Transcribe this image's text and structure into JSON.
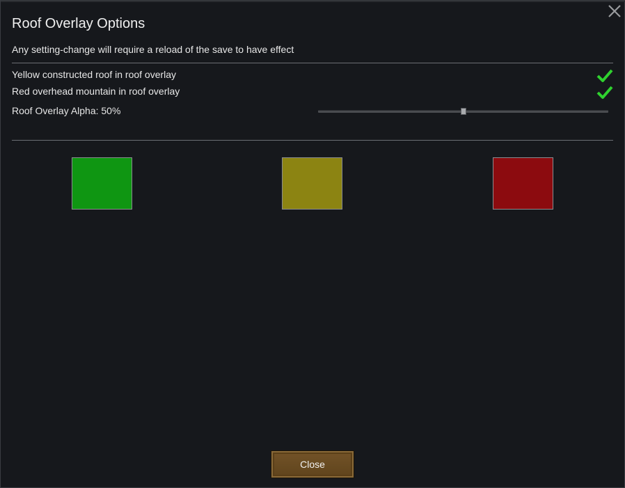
{
  "dialog": {
    "title": "Roof Overlay Options",
    "subtitle": "Any setting-change will require a reload of the save to have effect",
    "close_icon": "close-icon"
  },
  "options": [
    {
      "label": "Yellow constructed roof in roof overlay",
      "checked": true,
      "icon": "checkmark-icon"
    },
    {
      "label": "Red overhead mountain in roof overlay",
      "checked": true,
      "icon": "checkmark-icon"
    }
  ],
  "alpha": {
    "label": "Roof Overlay Alpha: 50%",
    "value": 0.5
  },
  "swatches": [
    {
      "name": "green",
      "color": "#0f9612"
    },
    {
      "name": "yellow",
      "color": "#8c8412"
    },
    {
      "name": "red",
      "color": "#8c0b0f"
    }
  ],
  "footer": {
    "close_label": "Close"
  },
  "colors": {
    "background": "#16181c",
    "check": "#2fd12f",
    "button": "#6b4d22"
  }
}
